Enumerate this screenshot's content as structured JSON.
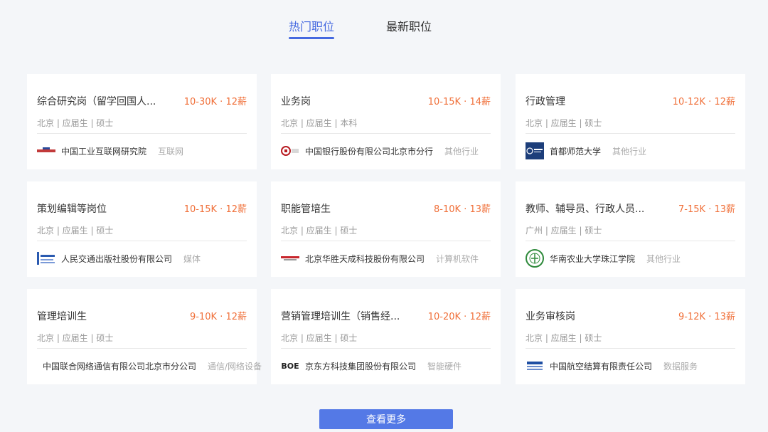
{
  "tabs": [
    {
      "label": "热门职位",
      "active": true
    },
    {
      "label": "最新职位",
      "active": false
    }
  ],
  "accent_color": "#4569e0",
  "salary_color": "#f0703a",
  "jobs": [
    {
      "title": "综合研究岗（留学回国人...",
      "salary": "10-30K · 12薪",
      "meta": "北京 | 应届生 | 硕士",
      "company": "中国工业互联网研究院",
      "industry": "互联网",
      "logo_icon": "caii-logo-icon"
    },
    {
      "title": "业务岗",
      "salary": "10-15K · 14薪",
      "meta": "北京 | 应届生 | 本科",
      "company": "中国银行股份有限公司北京市分行",
      "industry": "其他行业",
      "logo_icon": "bank-of-china-logo-icon"
    },
    {
      "title": "行政管理",
      "salary": "10-12K · 12薪",
      "meta": "北京 | 应届生 | 硕士",
      "company": "首都师范大学",
      "industry": "其他行业",
      "logo_icon": "cnu-logo-icon"
    },
    {
      "title": "策划编辑等岗位",
      "salary": "10-15K · 12薪",
      "meta": "北京 | 应届生 | 硕士",
      "company": "人民交通出版社股份有限公司",
      "industry": "媒体",
      "logo_icon": "publisher-logo-icon"
    },
    {
      "title": "职能管培生",
      "salary": "8-10K · 13薪",
      "meta": "北京 | 应届生 | 硕士",
      "company": "北京华胜天成科技股份有限公司",
      "industry": "计算机软件",
      "logo_icon": "teamsun-logo-icon"
    },
    {
      "title": "教师、辅导员、行政人员...",
      "salary": "7-15K · 13薪",
      "meta": "广州 | 应届生 | 硕士",
      "company": "华南农业大学珠江学院",
      "industry": "其他行业",
      "logo_icon": "scau-logo-icon"
    },
    {
      "title": "管理培训生",
      "salary": "9-10K · 12薪",
      "meta": "北京 | 应届生 | 硕士",
      "company": "中国联合网络通信有限公司北京市分公司",
      "industry": "通信/网络设备",
      "logo_icon": ""
    },
    {
      "title": "营销管理培训生（销售经...",
      "salary": "10-20K · 12薪",
      "meta": "北京 | 应届生 | 硕士",
      "company": "京东方科技集团股份有限公司",
      "industry": "智能硬件",
      "logo_icon": "boe-logo-icon",
      "logo_text": "BOE"
    },
    {
      "title": "业务审核岗",
      "salary": "9-12K · 13薪",
      "meta": "北京 | 应届生 | 硕士",
      "company": "中国航空结算有限责任公司",
      "industry": "数据服务",
      "logo_icon": "aviation-settlement-logo-icon"
    }
  ],
  "more_button": "查看更多"
}
